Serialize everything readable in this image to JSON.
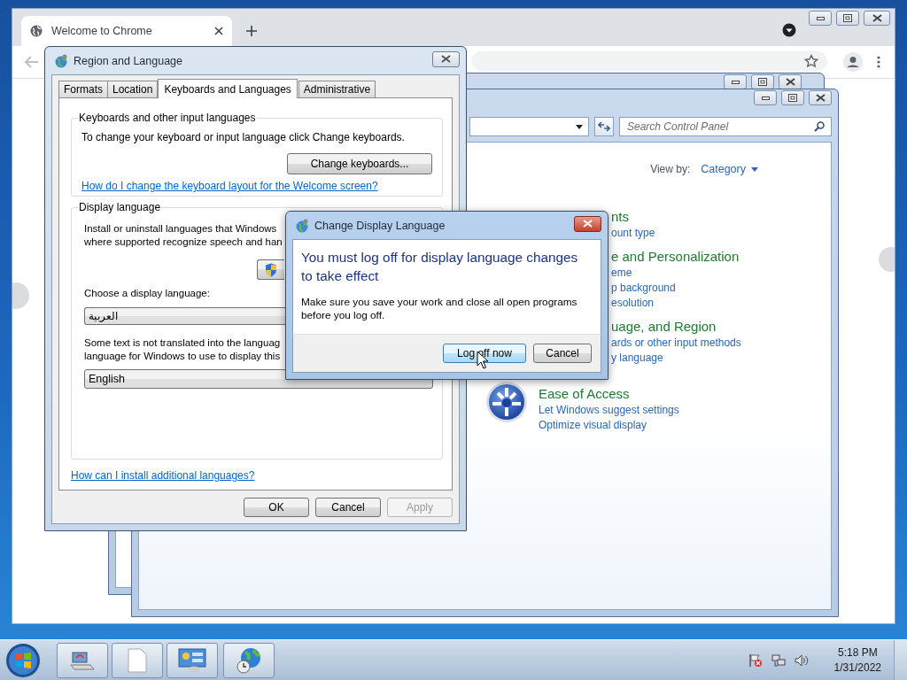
{
  "browser": {
    "tab": {
      "title": "Welcome to Chrome"
    }
  },
  "control_panel": {
    "search": {
      "placeholder": "Search Control Panel"
    },
    "view_by": {
      "label": "View by:",
      "value": "Category"
    },
    "categories": [
      {
        "kind": "partial",
        "title": "nts",
        "links": [
          "ount type"
        ]
      },
      {
        "kind": "partial",
        "title": "e and Personalization",
        "links": [
          "eme",
          "p background",
          "esolution"
        ]
      },
      {
        "kind": "partial",
        "title": "uage, and Region",
        "links": [
          "ards or other input methods",
          "y language"
        ]
      },
      {
        "kind": "full",
        "title": "Ease of Access",
        "links": [
          "Let Windows suggest settings",
          "Optimize visual display"
        ]
      }
    ]
  },
  "region_dialog": {
    "title": "Region and Language",
    "tabs": [
      {
        "label": "Formats",
        "selected": false
      },
      {
        "label": "Location",
        "selected": false
      },
      {
        "label": "Keyboards and Languages",
        "selected": true
      },
      {
        "label": "Administrative",
        "selected": false
      }
    ],
    "keyboards": {
      "legend": "Keyboards and other input languages",
      "text": "To change your keyboard or input language click Change keyboards.",
      "button": "Change keyboards...",
      "link": "How do I change the keyboard layout for the Welcome screen?"
    },
    "display": {
      "legend": "Display language",
      "text_lines": [
        "Install or uninstall languages that Windows",
        "where supported recognize speech and han"
      ],
      "choose_label": "Choose a display language:",
      "language": "العربية",
      "fallback_lines": [
        "Some text is not translated into the languag",
        "language for Windows to use to display this"
      ],
      "fallback_language": "English"
    },
    "help_link": "How can I install additional languages?",
    "buttons": [
      {
        "label": "OK",
        "disabled": false
      },
      {
        "label": "Cancel",
        "disabled": false
      },
      {
        "label": "Apply",
        "disabled": true
      }
    ]
  },
  "logoff_dialog": {
    "title": "Change Display Language",
    "heading": "You must log off for display language changes to take effect",
    "message": "Make sure you save your work and close all open programs before you log off.",
    "buttons": [
      {
        "label": "Log off now",
        "selected": true
      },
      {
        "label": "Cancel",
        "selected": false
      }
    ]
  },
  "taskbar": {
    "time": "5:18 PM",
    "date": "1/31/2022"
  }
}
